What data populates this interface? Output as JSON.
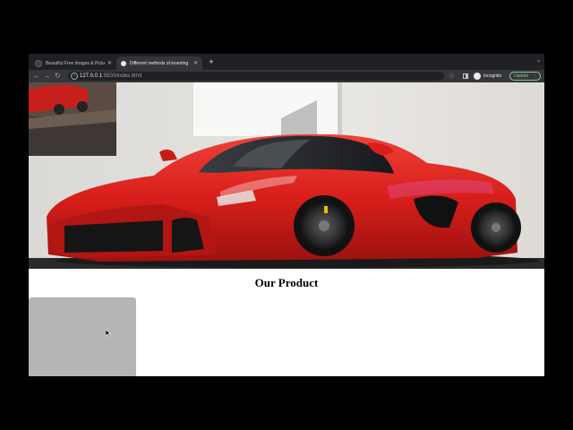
{
  "browser": {
    "tabs": [
      {
        "title": "Beautiful Free Images & Pictur",
        "active": false
      },
      {
        "title": "Different methods of inserting",
        "active": true
      }
    ],
    "new_tab_icon": "plus-icon",
    "address": {
      "host": "127.0.0.1",
      "path": ":5500/index.html"
    },
    "incognito_label": "Incognito",
    "update_label": "Update"
  },
  "page": {
    "heading": "Our Product"
  },
  "colors": {
    "tab_bar": "#202124",
    "toolbar": "#35363a",
    "update_accent": "#81c995",
    "car_red": "#d81e1a",
    "product_card": "#b5b5b5"
  }
}
